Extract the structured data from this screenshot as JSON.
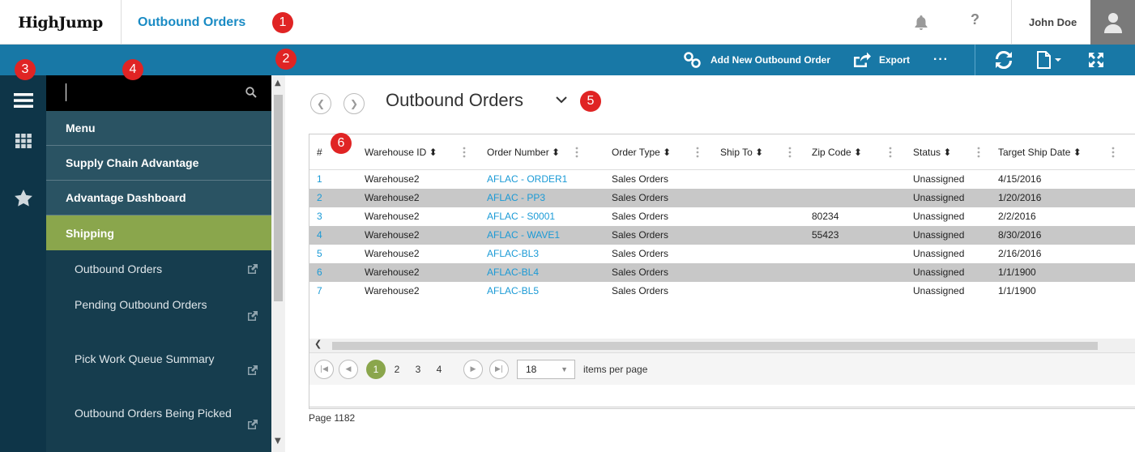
{
  "header": {
    "logo": "HighJump",
    "app_title": "Outbound Orders",
    "help_glyph": "?",
    "user_name": "John Doe"
  },
  "toolbar": {
    "add_new": "Add New Outbound Order",
    "export": "Export",
    "more": "···"
  },
  "callouts": [
    "1",
    "2",
    "3",
    "4",
    "5",
    "6"
  ],
  "sidebar": {
    "search_placeholder": "",
    "menu_items": [
      {
        "label": "Menu"
      },
      {
        "label": "Supply Chain Advantage"
      },
      {
        "label": "Advantage Dashboard"
      },
      {
        "label": "Shipping",
        "active": true
      }
    ],
    "sub_items": [
      {
        "label": "Outbound Orders"
      },
      {
        "label": "Pending Outbound Orders"
      },
      {
        "label": "Pick Work Queue Summary"
      },
      {
        "label": "Outbound Orders Being Picked"
      }
    ]
  },
  "main": {
    "page_title": "Outbound Orders",
    "columns": [
      "#",
      "Warehouse ID",
      "Order Number",
      "Order Type",
      "Ship To",
      "Zip Code",
      "Status",
      "Target Ship Date"
    ],
    "sort_glyph": "⬍",
    "rows": [
      [
        "1",
        "Warehouse2",
        "AFLAC - ORDER1",
        "Sales Orders",
        "",
        "",
        "Unassigned",
        "4/15/2016"
      ],
      [
        "2",
        "Warehouse2",
        "AFLAC - PP3",
        "Sales Orders",
        "",
        "",
        "Unassigned",
        "1/20/2016"
      ],
      [
        "3",
        "Warehouse2",
        "AFLAC - S0001",
        "Sales Orders",
        "",
        "80234",
        "Unassigned",
        "2/2/2016"
      ],
      [
        "4",
        "Warehouse2",
        "AFLAC - WAVE1",
        "Sales Orders",
        "",
        "55423",
        "Unassigned",
        "8/30/2016"
      ],
      [
        "5",
        "Warehouse2",
        "AFLAC-BL3",
        "Sales Orders",
        "",
        "",
        "Unassigned",
        "2/16/2016"
      ],
      [
        "6",
        "Warehouse2",
        "AFLAC-BL4",
        "Sales Orders",
        "",
        "",
        "Unassigned",
        "1/1/1900"
      ],
      [
        "7",
        "Warehouse2",
        "AFLAC-BL5",
        "Sales Orders",
        "",
        "",
        "Unassigned",
        "1/1/1900"
      ]
    ],
    "pager": {
      "pages": [
        "1",
        "2",
        "3",
        "4"
      ],
      "current_page": "1",
      "page_size": "18",
      "page_size_label": "items per page"
    },
    "footer": "Page 1182"
  },
  "colors": {
    "toolbar": "#1878a6",
    "rail": "#0e3548",
    "sidebar": "#163d4e",
    "menu_item": "#2a5363",
    "active": "#8aa64c",
    "link": "#1a9ad6",
    "alt_row": "#c8c8c8",
    "callout": "#e02424"
  }
}
